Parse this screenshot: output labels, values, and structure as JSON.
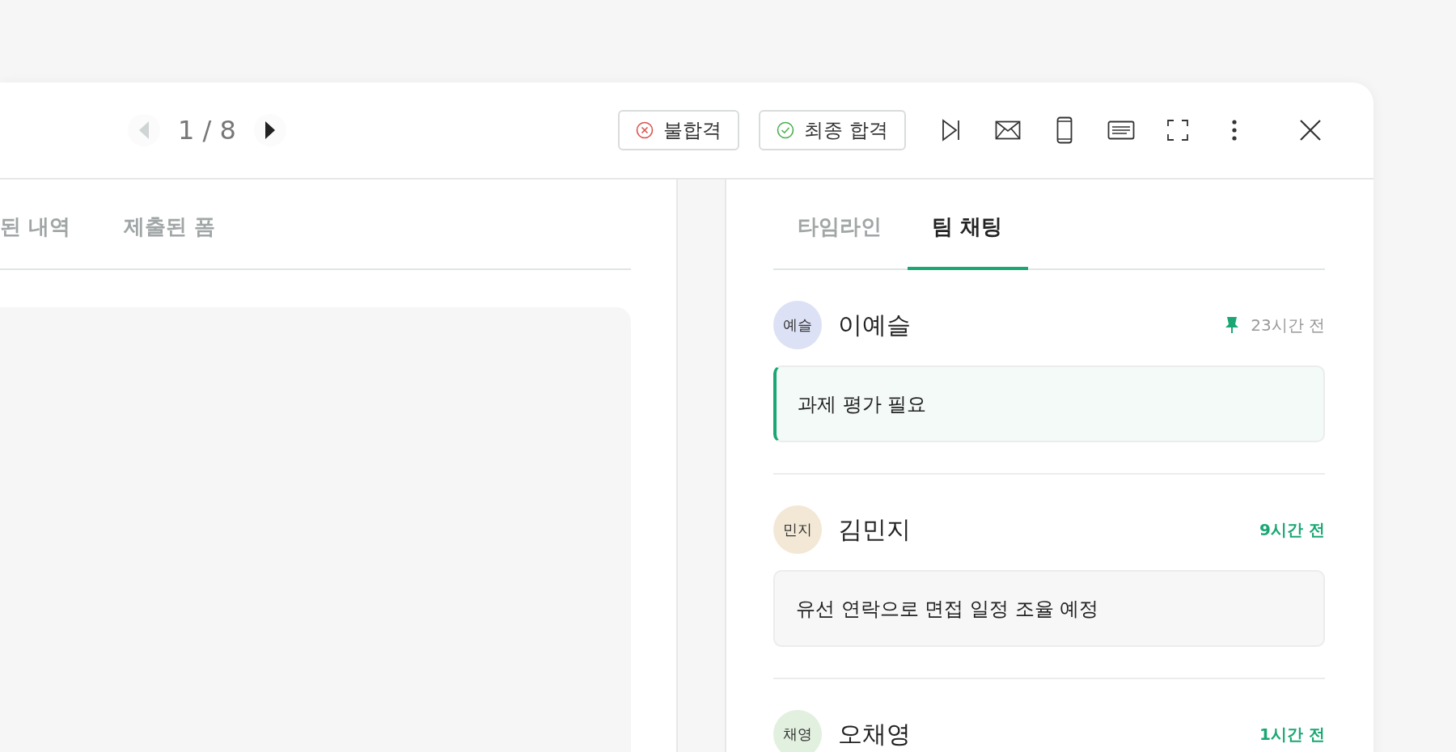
{
  "pager": {
    "current": "1 / 8"
  },
  "actions": [
    {
      "label": "불합격",
      "kind": "reject"
    },
    {
      "label": "최종 합격",
      "kind": "accept"
    }
  ],
  "toolbar": [
    {
      "kind": "skip"
    },
    {
      "kind": "mail"
    },
    {
      "kind": "phone"
    },
    {
      "kind": "message"
    },
    {
      "kind": "fullscreen"
    },
    {
      "kind": "more"
    },
    {
      "kind": "close"
    }
  ],
  "left_tabs": [
    {
      "label": "된 내역",
      "selected": false
    },
    {
      "label": "제출된 폼",
      "selected": false
    }
  ],
  "right_tabs": [
    {
      "label": "타임라인",
      "selected": false
    },
    {
      "label": "팀 채팅",
      "selected": true
    }
  ],
  "messages": [
    {
      "initials": "예슬",
      "author": "이예슬",
      "color": "#dce1f5",
      "time": "23시간 전",
      "pinned": true,
      "time_highlighted": false,
      "text": "과제 평가 필요"
    },
    {
      "initials": "민지",
      "author": "김민지",
      "color": "#f3e8d6",
      "time": "9시간 전",
      "pinned": false,
      "time_highlighted": true,
      "text": "유선 연락으로 면접 일정 조율 예정"
    },
    {
      "initials": "채영",
      "author": "오채영",
      "color": "#e2f0df",
      "time": "1시간 전",
      "pinned": false,
      "time_highlighted": true
    }
  ]
}
